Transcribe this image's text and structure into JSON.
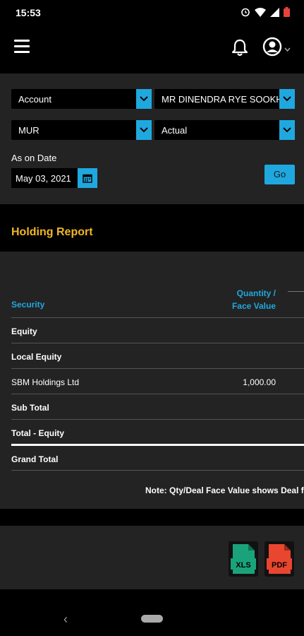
{
  "status": {
    "time": "15:53"
  },
  "filters": {
    "account_type": "Account",
    "account_name": "MR DINENDRA RYE SOOKHA",
    "currency": "MUR",
    "view": "Actual",
    "as_on_label": "As on Date",
    "date": "May 03, 2021",
    "go_label": "Go"
  },
  "report": {
    "title": "Holding Report",
    "col_security": "Security",
    "col_qty_line1": "Quantity /",
    "col_qty_line2": "Face Value",
    "rows": [
      {
        "label": "Equity",
        "value": "",
        "bold": true
      },
      {
        "label": "Local Equity",
        "value": "",
        "bold": true
      },
      {
        "label": "SBM Holdings Ltd",
        "value": "1,000.00",
        "bold": false
      },
      {
        "label": "Sub Total",
        "value": "",
        "bold": true
      },
      {
        "label": "Total - Equity",
        "value": "",
        "bold": true
      },
      {
        "label": "Grand Total",
        "value": "",
        "bold": true
      }
    ],
    "note": "Note: Qty/Deal Face Value shows Deal fa"
  },
  "export": {
    "xls_label": "XLS",
    "pdf_label": "PDF"
  },
  "colors": {
    "accent": "#1fa8df",
    "title": "#f2b823",
    "panel": "#232323",
    "xls": "#1aa37a",
    "pdf": "#e8462f"
  }
}
